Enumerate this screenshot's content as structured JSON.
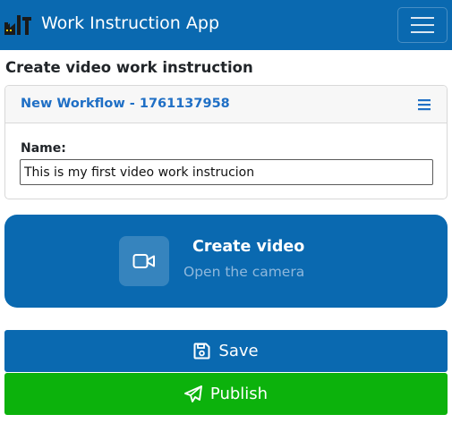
{
  "navbar": {
    "app_title": "Work Instruction App",
    "logo_icon": "factory-logo-icon",
    "menu_icon": "hamburger-menu-icon",
    "background_color": "#0a69b0"
  },
  "page": {
    "heading": "Create video work instruction"
  },
  "workflow_card": {
    "title": "New Workflow - 1761137958",
    "menu_icon": "list-menu-icon",
    "title_color": "#1f6fc5",
    "name_label": "Name:",
    "name_value": "This is my first video work instrucion"
  },
  "create_video": {
    "title": "Create video",
    "subtitle": "Open the camera",
    "icon": "video-camera-icon",
    "background_color": "#0a69b0"
  },
  "actions": {
    "save_label": "Save",
    "save_icon": "floppy-disk-icon",
    "save_color": "#0a69b0",
    "publish_label": "Publish",
    "publish_icon": "paper-plane-icon",
    "publish_color": "#0cb20c"
  }
}
